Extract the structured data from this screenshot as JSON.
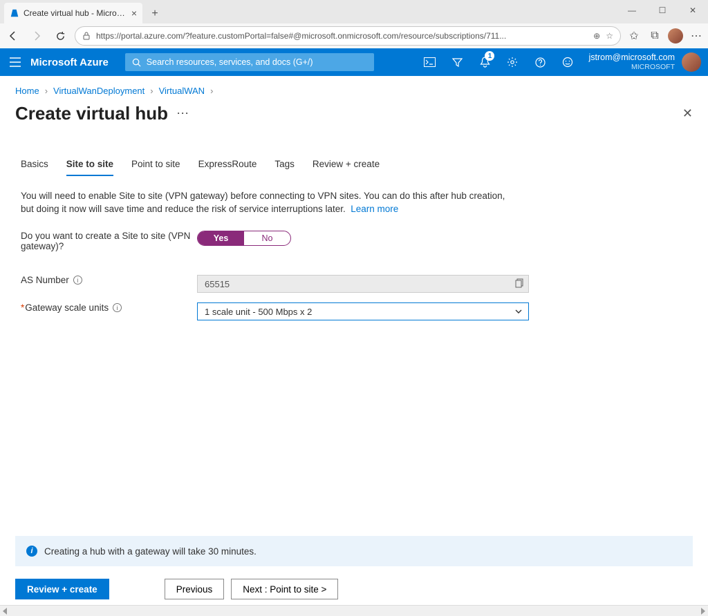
{
  "browser": {
    "tab_title": "Create virtual hub - Microsoft Az",
    "url": "https://portal.azure.com/?feature.customPortal=false#@microsoft.onmicrosoft.com/resource/subscriptions/711..."
  },
  "azure": {
    "brand": "Microsoft Azure",
    "search_placeholder": "Search resources, services, and docs (G+/)",
    "notification_badge": "1",
    "user_email": "jstrom@microsoft.com",
    "user_org": "MICROSOFT"
  },
  "breadcrumbs": {
    "items": [
      "Home",
      "VirtualWanDeployment",
      "VirtualWAN"
    ]
  },
  "page": {
    "title": "Create virtual hub",
    "tabs": [
      "Basics",
      "Site to site",
      "Point to site",
      "ExpressRoute",
      "Tags",
      "Review + create"
    ],
    "active_tab": "Site to site",
    "description": "You will need to enable Site to site (VPN gateway) before connecting to VPN sites. You can do this after hub creation, but doing it now will save time and reduce the risk of service interruptions later.",
    "learn_more": "Learn more"
  },
  "form": {
    "s2s_label": "Do you want to create a Site to site (VPN gateway)?",
    "toggle_yes": "Yes",
    "toggle_no": "No",
    "asn_label": "AS Number",
    "asn_value": "65515",
    "gsu_label": "Gateway scale units",
    "gsu_value": "1 scale unit - 500 Mbps x 2"
  },
  "banner": {
    "text": "Creating a hub with a gateway will take 30 minutes."
  },
  "footer": {
    "review": "Review + create",
    "previous": "Previous",
    "next": "Next : Point to site >"
  }
}
